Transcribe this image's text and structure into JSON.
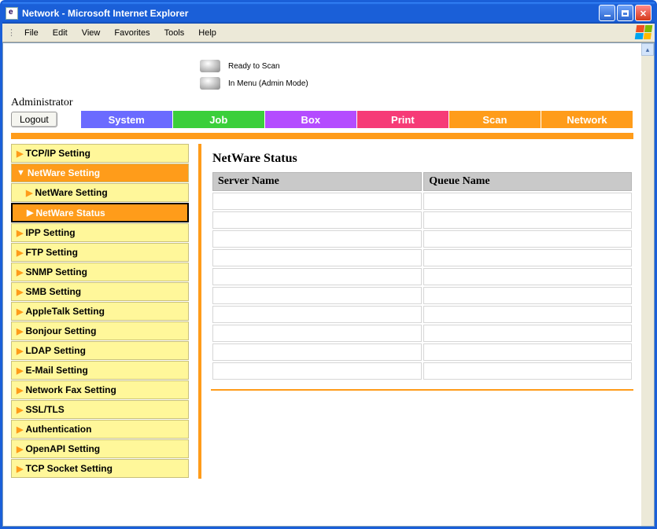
{
  "window": {
    "title": "Network - Microsoft Internet Explorer"
  },
  "menu": {
    "items": [
      "File",
      "Edit",
      "View",
      "Favorites",
      "Tools",
      "Help"
    ]
  },
  "status": {
    "line1": "Ready to Scan",
    "line2": "In Menu (Admin Mode)"
  },
  "header": {
    "admin_label": "Administrator",
    "logout_label": "Logout"
  },
  "tabs": {
    "system": "System",
    "job": "Job",
    "box": "Box",
    "print": "Print",
    "scan": "Scan",
    "network": "Network"
  },
  "sidebar": {
    "items": [
      {
        "label": "TCP/IP Setting",
        "arrow": "▶",
        "level": 1
      },
      {
        "label": "NetWare Setting",
        "arrow": "▼",
        "level": 1,
        "expanded": true
      },
      {
        "label": "NetWare Setting",
        "arrow": "▶",
        "level": 2
      },
      {
        "label": "NetWare Status",
        "arrow": "▶",
        "level": 2,
        "selected": true
      },
      {
        "label": "IPP Setting",
        "arrow": "▶",
        "level": 1
      },
      {
        "label": "FTP Setting",
        "arrow": "▶",
        "level": 1
      },
      {
        "label": "SNMP Setting",
        "arrow": "▶",
        "level": 1
      },
      {
        "label": "SMB Setting",
        "arrow": "▶",
        "level": 1
      },
      {
        "label": "AppleTalk Setting",
        "arrow": "▶",
        "level": 1
      },
      {
        "label": "Bonjour Setting",
        "arrow": "▶",
        "level": 1
      },
      {
        "label": "LDAP Setting",
        "arrow": "▶",
        "level": 1
      },
      {
        "label": "E-Mail Setting",
        "arrow": "▶",
        "level": 1
      },
      {
        "label": "Network Fax Setting",
        "arrow": "▶",
        "level": 1
      },
      {
        "label": "SSL/TLS",
        "arrow": "▶",
        "level": 1
      },
      {
        "label": "Authentication",
        "arrow": "▶",
        "level": 1
      },
      {
        "label": "OpenAPI Setting",
        "arrow": "▶",
        "level": 1
      },
      {
        "label": "TCP Socket Setting",
        "arrow": "▶",
        "level": 1
      }
    ]
  },
  "main": {
    "title": "NetWare Status",
    "columns": {
      "server": "Server Name",
      "queue": "Queue Name"
    },
    "rows": [
      {
        "server": "",
        "queue": ""
      },
      {
        "server": "",
        "queue": ""
      },
      {
        "server": "",
        "queue": ""
      },
      {
        "server": "",
        "queue": ""
      },
      {
        "server": "",
        "queue": ""
      },
      {
        "server": "",
        "queue": ""
      },
      {
        "server": "",
        "queue": ""
      },
      {
        "server": "",
        "queue": ""
      },
      {
        "server": "",
        "queue": ""
      },
      {
        "server": "",
        "queue": ""
      }
    ]
  }
}
